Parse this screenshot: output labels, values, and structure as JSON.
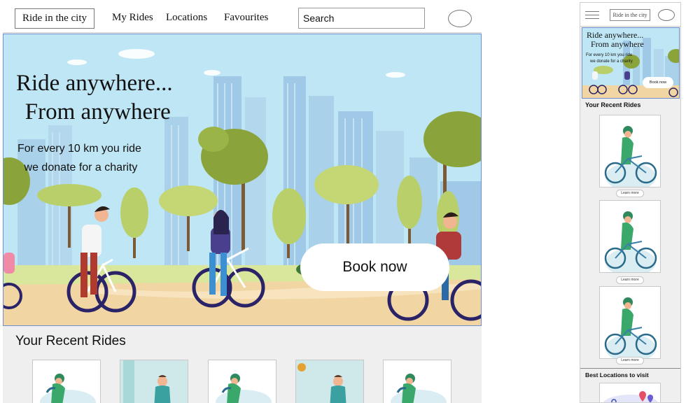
{
  "desktop": {
    "nav": {
      "brand": "Ride in the city",
      "links": [
        "My Rides",
        "Locations",
        "Favourites"
      ],
      "search_value": "Search"
    },
    "hero": {
      "title_line1": "Ride anywhere...",
      "title_line2": "From anywhere",
      "subtitle_line1": "For every 10 km you ride",
      "subtitle_line2": "we donate for a charity",
      "book_label": "Book now"
    },
    "recent": {
      "heading": "Your Recent Rides",
      "card_count": 5
    }
  },
  "mobile": {
    "nav": {
      "brand": "Ride in the city"
    },
    "hero": {
      "title_line1": "Ride anywhere...",
      "title_line2": "From anywhere",
      "subtitle_line1": "For every 10 km you ride",
      "subtitle_line2": "we donate for a charity",
      "book_label": "Book now"
    },
    "recent": {
      "heading": "Your Recent Rides",
      "learn_more": [
        "Learn more",
        "Learn more",
        "Learn more"
      ]
    },
    "best_locations": {
      "heading": "Best Locations to visit"
    }
  },
  "colors": {
    "sky": "#bfe6f4",
    "building": "#9fc9e6",
    "tree_dark": "#8aa43b",
    "tree_light": "#b9cf6a",
    "path": "#f1d6a4",
    "hero_border": "#6e8fd0"
  }
}
